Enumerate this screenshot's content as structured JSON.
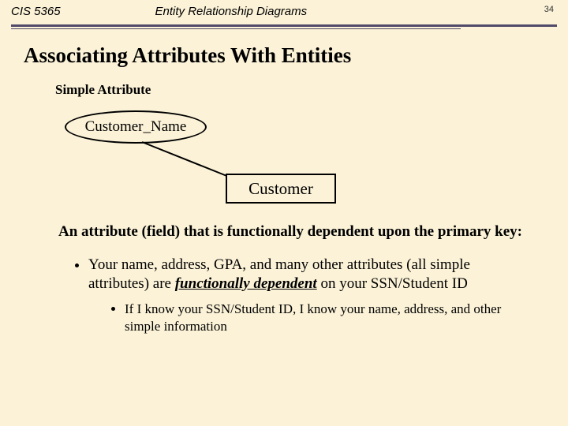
{
  "header": {
    "left": "CIS 5365",
    "center": "Entity Relationship Diagrams",
    "page_number": "34"
  },
  "title": "Associating Attributes With Entities",
  "subtitle": "Simple Attribute",
  "diagram": {
    "attribute_label": "Customer_Name",
    "entity_label": "Customer"
  },
  "definition": "An attribute (field) that is functionally dependent upon the primary key:",
  "bullet1_pre": "Your name, address, GPA, and many other attributes (all simple attributes) are ",
  "bullet1_emph": "functionally dependent",
  "bullet1_post": " on your SSN/Student ID",
  "subbullet1": "If I know your SSN/Student ID, I know your name, address, and other simple information"
}
